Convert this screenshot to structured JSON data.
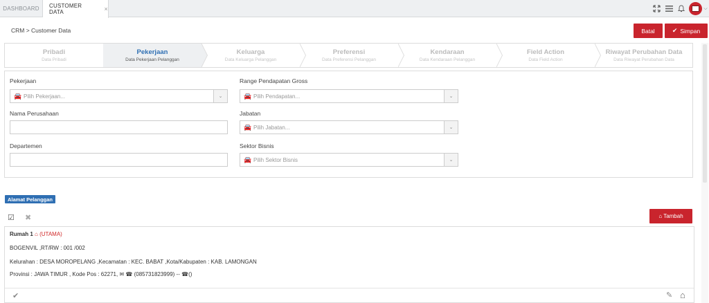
{
  "tabs": [
    {
      "label": "DASHBOARD"
    },
    {
      "label": "CUSTOMER DATA",
      "close": "×"
    }
  ],
  "topbar_icons": [
    "fullscreen-icon",
    "menu-icon",
    "bell-icon",
    "user-avatar"
  ],
  "breadcrumb": "CRM > Customer Data",
  "actions": {
    "batal": "Batal",
    "simpan": "Simpan"
  },
  "steps": [
    {
      "title": "Pribadi",
      "sub": "Data Pribadi"
    },
    {
      "title": "Pekerjaan",
      "sub": "Data Pekerjaan Pelanggan",
      "active": true
    },
    {
      "title": "Keluarga",
      "sub": "Data Keluarga Pelanggan"
    },
    {
      "title": "Preferensi",
      "sub": "Data Preferensi Pelanggan"
    },
    {
      "title": "Kendaraan",
      "sub": "Data Kendaraan Pelanggan"
    },
    {
      "title": "Field Action",
      "sub": "Data Field Action"
    },
    {
      "title": "Riwayat Perubahan Data",
      "sub": "Data Riwayat Perubahan Data"
    }
  ],
  "form": {
    "pekerjaan": {
      "label": "Pekerjaan",
      "placeholder": "Pilih Pekerjaan..."
    },
    "nama_perusahaan": {
      "label": "Nama Perusahaan",
      "value": ""
    },
    "departemen": {
      "label": "Departemen",
      "value": ""
    },
    "pendapatan": {
      "label": "Range Pendapatan Gross",
      "placeholder": "Pilih Pendapatan..."
    },
    "jabatan": {
      "label": "Jabatan",
      "placeholder": "Pilih Jabatan..."
    },
    "sektor": {
      "label": "Sektor Bisnis",
      "placeholder": "Pilih Sektor Bisnis"
    }
  },
  "alamat": {
    "badge": "Alamat Pelanggan",
    "tambah": "Tambah",
    "title": "Rumah 1",
    "utama": "(UTAMA)",
    "line1": "BOGENVIL ,RT/RW : 001 /002",
    "line2": "Kelurahan : DESA MOROPELANG ,Kecamatan : KEC. BABAT ,Kota/Kabupaten : KAB. LAMONGAN",
    "line3_pre": "Provinsi : JAWA TIMUR , Kode Pos : 62271,",
    "phone1": "(085731823999)",
    "sep": " -- ",
    "phone2": "()"
  },
  "colors": {
    "accent_red": "#c9242d",
    "accent_blue": "#2f6fb3"
  }
}
